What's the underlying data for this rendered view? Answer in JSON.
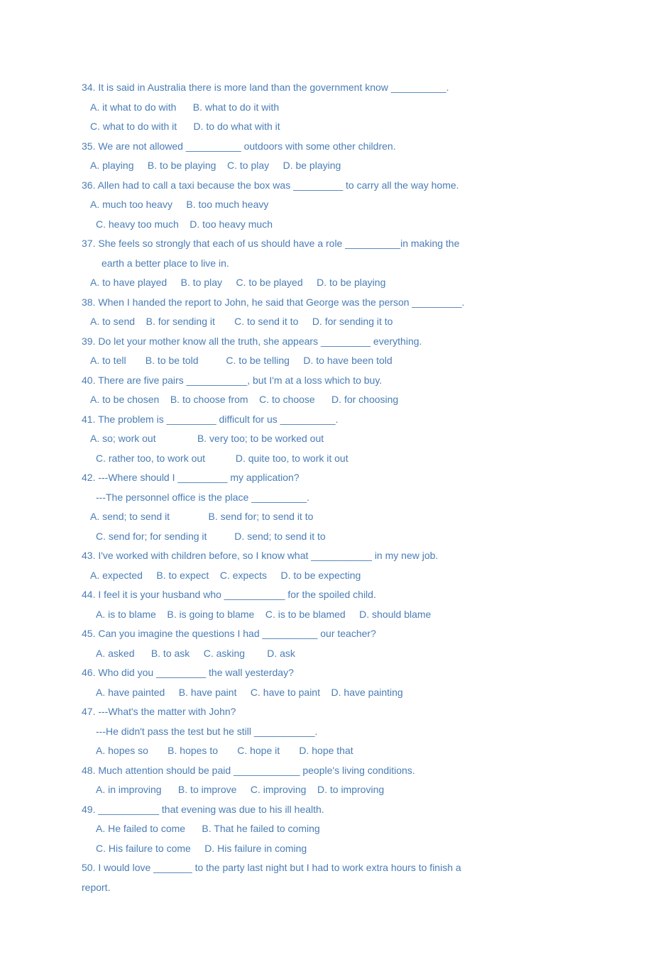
{
  "lines": [
    {
      "cls": "",
      "text": "34. It is said in Australia there is more land than the government know __________."
    },
    {
      "cls": "indent-a",
      "text": "A. it what to do with      B. what to do it with"
    },
    {
      "cls": "indent-a",
      "text": "C. what to do with it      D. to do what with it"
    },
    {
      "cls": "",
      "text": "35. We are not allowed __________ outdoors with some other children."
    },
    {
      "cls": "indent-a",
      "text": "A. playing     B. to be playing    C. to play     D. be playing"
    },
    {
      "cls": "",
      "text": "36. Allen had to call a taxi because the box was _________ to carry all the way home."
    },
    {
      "cls": "indent-a",
      "text": "A. much too heavy     B. too much heavy"
    },
    {
      "cls": "indent-b",
      "text": "C. heavy too much    D. too heavy much"
    },
    {
      "cls": "",
      "text": "37. She feels so strongly that each of us should have a role __________in making the"
    },
    {
      "cls": "indent-c",
      "text": "earth a better place to live in."
    },
    {
      "cls": "indent-a",
      "text": "A. to have played     B. to play     C. to be played     D. to be playing"
    },
    {
      "cls": "",
      "text": "38. When I handed the report to John, he said that George was the person _________."
    },
    {
      "cls": "indent-a",
      "text": "A. to send    B. for sending it       C. to send it to     D. for sending it to"
    },
    {
      "cls": "",
      "text": "39. Do let your mother know all the truth, she appears _________ everything."
    },
    {
      "cls": "indent-a",
      "text": "A. to tell       B. to be told          C. to be telling     D. to have been told"
    },
    {
      "cls": "",
      "text": "40. There are five pairs ___________, but I'm at a loss which to buy."
    },
    {
      "cls": "indent-a",
      "text": "A. to be chosen    B. to choose from    C. to choose      D. for choosing"
    },
    {
      "cls": "",
      "text": "41. The problem is _________ difficult for us __________."
    },
    {
      "cls": "indent-a",
      "text": "A. so; work out               B. very too; to be worked out"
    },
    {
      "cls": "indent-b",
      "text": "C. rather too, to work out           D. quite too, to work it out"
    },
    {
      "cls": "",
      "text": "42. ---Where should I _________ my application?"
    },
    {
      "cls": "indent-b",
      "text": "---The personnel office is the place __________."
    },
    {
      "cls": "indent-a",
      "text": "A. send; to send it              B. send for; to send it to"
    },
    {
      "cls": "indent-b",
      "text": "C. send for; for sending it          D. send; to send it to"
    },
    {
      "cls": "",
      "text": "43. I've worked with children before, so I know what ___________ in my new job."
    },
    {
      "cls": "indent-a",
      "text": "A. expected     B. to expect    C. expects     D. to be expecting"
    },
    {
      "cls": "",
      "text": "44. I feel it is your husband who ___________ for the spoiled child."
    },
    {
      "cls": "indent-b",
      "text": "A. is to blame    B. is going to blame    C. is to be blamed     D. should blame"
    },
    {
      "cls": "",
      "text": "45. Can you imagine the questions I had __________ our teacher?"
    },
    {
      "cls": "indent-b",
      "text": "A. asked      B. to ask     C. asking        D. ask"
    },
    {
      "cls": "",
      "text": "46. Who did you _________ the wall yesterday?"
    },
    {
      "cls": "indent-b",
      "text": "A. have painted     B. have paint     C. have to paint    D. have painting"
    },
    {
      "cls": "",
      "text": "47. ---What's the matter with John?"
    },
    {
      "cls": "indent-b",
      "text": "---He didn't pass the test but he still ___________."
    },
    {
      "cls": "indent-b",
      "text": "A. hopes so       B. hopes to       C. hope it       D. hope that"
    },
    {
      "cls": "",
      "text": "48. Much attention should be paid ____________ people's living conditions."
    },
    {
      "cls": "indent-b",
      "text": "A. in improving      B. to improve     C. improving    D. to improving"
    },
    {
      "cls": "",
      "text": "49. ___________ that evening was due to his ill health."
    },
    {
      "cls": "indent-b",
      "text": "A. He failed to come      B. That he failed to coming"
    },
    {
      "cls": "indent-b",
      "text": "C. His failure to come     D. His failure in coming"
    },
    {
      "cls": "",
      "text": "50. I would love _______ to the party last night but I had to work extra hours to finish a"
    },
    {
      "cls": "",
      "text": "report."
    }
  ]
}
